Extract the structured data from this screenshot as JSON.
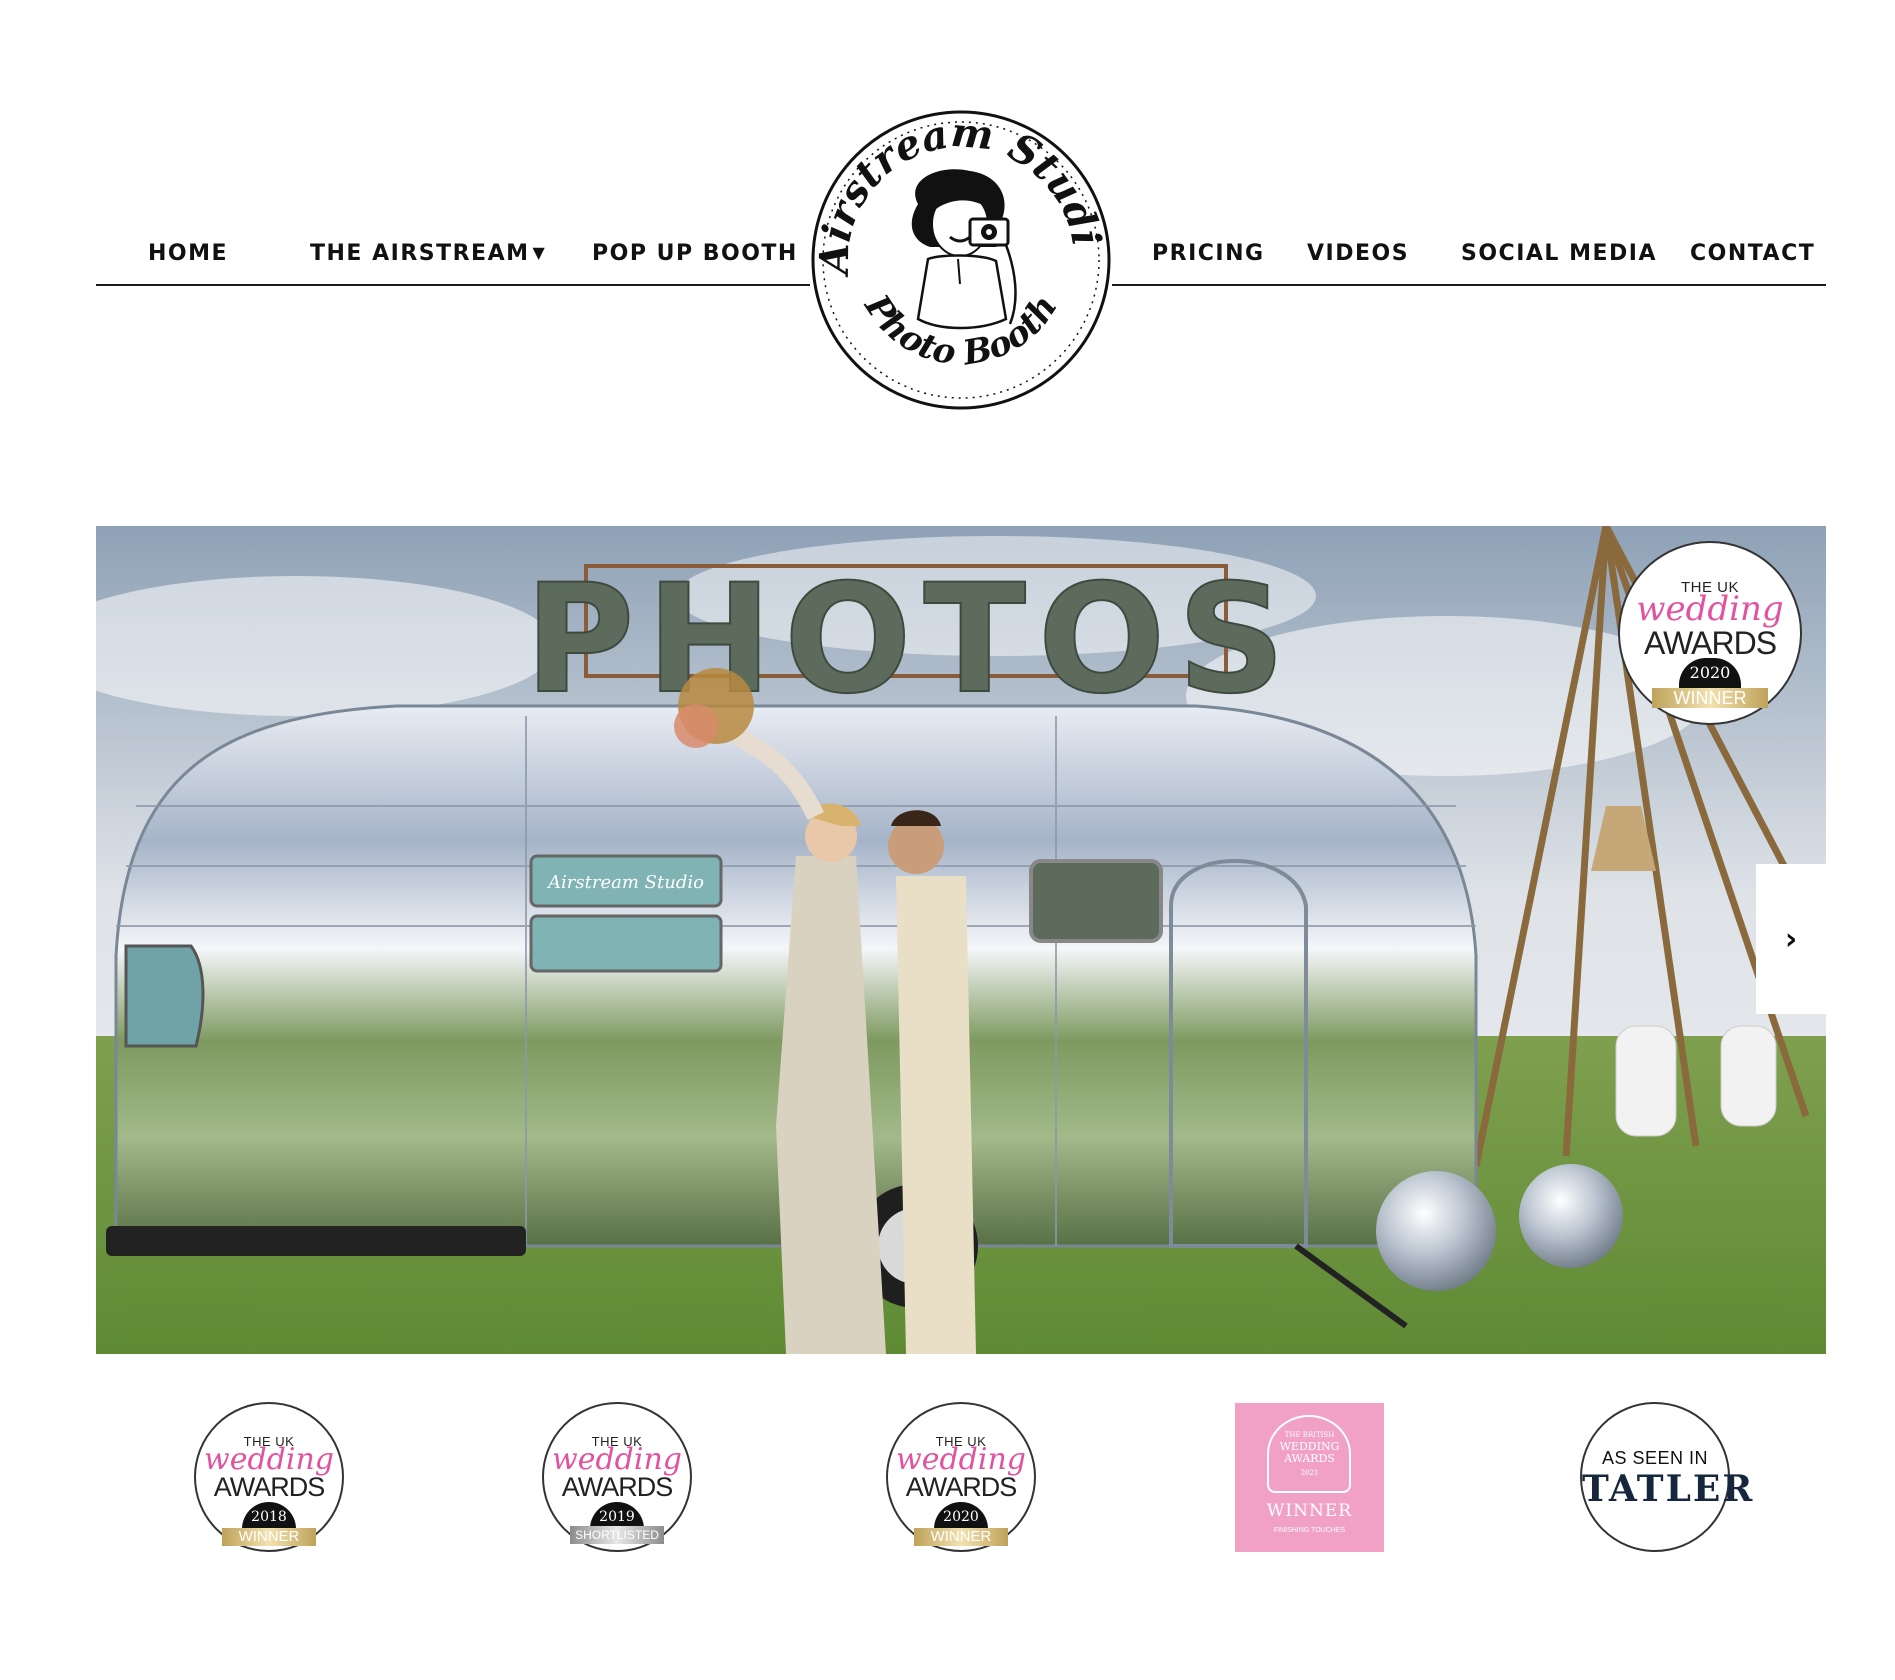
{
  "nav": {
    "items": [
      {
        "label": "HOME"
      },
      {
        "label": "THE AIRSTREAM",
        "caret": "▼"
      },
      {
        "label": "POP UP BOOTH"
      },
      {
        "label": "PRICING"
      },
      {
        "label": "VIDEOS"
      },
      {
        "label": "SOCIAL MEDIA"
      },
      {
        "label": "CONTACT"
      }
    ]
  },
  "logo": {
    "top_text": "Airstream Studio",
    "bottom_text": "Photo Booth"
  },
  "hero": {
    "sign_text": "PHOTOS",
    "trailer_sign": "Airstream Studio",
    "next_icon": "›",
    "badge": {
      "line1": "THE UK",
      "script": "wedding",
      "awards": "AWARDS",
      "year": "2020",
      "ribbon": "WINNER"
    }
  },
  "badges": [
    {
      "line1": "THE UK",
      "script": "wedding",
      "awards": "AWARDS",
      "year": "2018",
      "ribbon": "WINNER"
    },
    {
      "line1": "THE UK",
      "script": "wedding",
      "awards": "AWARDS",
      "year": "2019",
      "ribbon": "SHORTLISTED"
    },
    {
      "line1": "THE UK",
      "script": "wedding",
      "awards": "AWARDS",
      "year": "2020",
      "ribbon": "WINNER"
    },
    {
      "line1": "THE BRITISH",
      "title": "WEDDING AWARDS",
      "year": "2021",
      "main": "WINNER",
      "sub": "FINISHING TOUCHES"
    },
    {
      "line1": "AS SEEN IN",
      "brand": "TATLER"
    }
  ],
  "colors": {
    "accent_pink": "#e2539f",
    "square_badge": "#f2a1c6",
    "gold": "#c7a85f"
  }
}
